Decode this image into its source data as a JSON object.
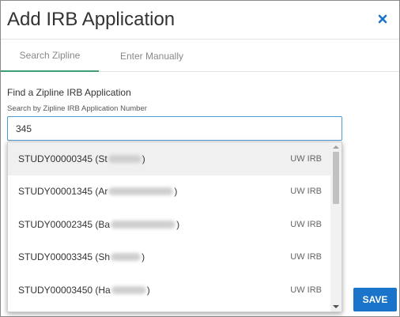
{
  "dialog": {
    "title": "Add IRB Application",
    "close_icon": "close-icon",
    "close_color": "#1a74c9"
  },
  "tabs": [
    {
      "label": "Search Zipline",
      "active": true
    },
    {
      "label": "Enter Manually",
      "active": false
    }
  ],
  "search": {
    "section_label": "Find a Zipline IRB Application",
    "field_label": "Search by Zipline IRB Application Number",
    "value": "345"
  },
  "results": [
    {
      "prefix": "STUDY00000345 (St",
      "suffix": ")",
      "source": "UW IRB"
    },
    {
      "prefix": "STUDY00001345 (Ar",
      "suffix": ")",
      "source": "UW IRB"
    },
    {
      "prefix": "STUDY00002345 (Ba",
      "suffix": ")",
      "source": "UW IRB"
    },
    {
      "prefix": "STUDY00003345 (Sh",
      "suffix": ")",
      "source": "UW IRB"
    },
    {
      "prefix": "STUDY00003450 (Ha",
      "suffix": ")",
      "source": "UW IRB"
    }
  ],
  "actions": {
    "save_label": "SAVE"
  },
  "colors": {
    "accent": "#1a74c9",
    "tab_underline": "#3d9c73",
    "input_border": "#4a9ad4"
  }
}
